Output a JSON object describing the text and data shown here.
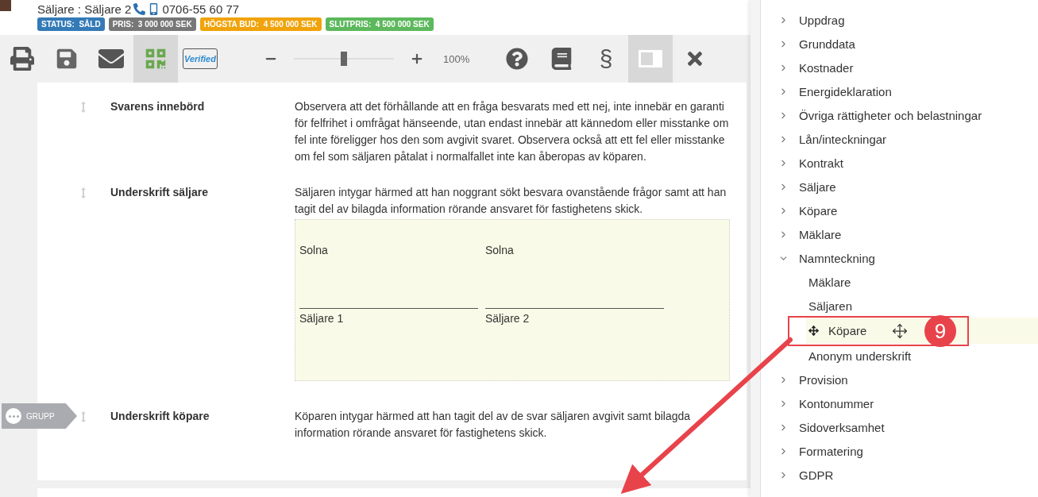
{
  "header": {
    "seller": "Säljare : Säljare 2",
    "phone": "0706-55 60 77",
    "badges": [
      {
        "label": "STATUS:  SÅLD",
        "color": "#337ab7"
      },
      {
        "label": "PRIS:  3 000 000 SEK",
        "color": "#777777"
      },
      {
        "label": "HÖGSTA BUD:  4 500 000 SEK",
        "color": "#f0a30a"
      },
      {
        "label": "SLUTPRIS:  4 500 000 SEK",
        "color": "#5cb85c"
      }
    ]
  },
  "toolbar": {
    "left": [
      {
        "kind": "print",
        "selected": false
      },
      {
        "kind": "save",
        "selected": false
      },
      {
        "kind": "mail",
        "selected": false
      },
      {
        "kind": "qr",
        "selected": true
      },
      {
        "kind": "verified",
        "label": "Verified",
        "selected": false
      }
    ],
    "zoom": {
      "level": 0.5,
      "reading": "100%"
    },
    "right": [
      {
        "kind": "help",
        "selected": false
      },
      {
        "kind": "book",
        "selected": false
      },
      {
        "kind": "section",
        "label": "§",
        "selected": false
      },
      {
        "kind": "panel",
        "selected": true
      },
      {
        "kind": "close",
        "selected": false
      }
    ]
  },
  "sections": [
    {
      "kind": "text",
      "label": "Svarens innebörd",
      "text": "Observera att det förhållande att en fråga besvarats med ett nej, inte innebär en garanti för felfrihet i omfrågat hänseende, utan endast innebär att kännedom eller misstanke om fel inte föreligger hos den som avgivit svaret. Observera också att ett fel eller misstanke om fel som säljaren påtalat i normalfallet inte kan åberopas av köparen."
    },
    {
      "kind": "signature",
      "label": "Underskrift säljare",
      "text": "Säljaren intygar härmed att han noggrant sökt besvara ovanstående frågor samt att han tagit del av bilagda information rörande ansvaret för fastighetens skick.",
      "signers": [
        {
          "place": "Solna",
          "name": "Säljare 1"
        },
        {
          "place": "Solna",
          "name": "Säljare 2"
        }
      ]
    },
    {
      "kind": "text",
      "label": "Underskrift köpare",
      "text": "Köparen intygar härmed att han tagit del av de svar säljaren avgivit samt bilagda information rörande ansvaret för fastighetens skick."
    }
  ],
  "group_tag": {
    "label": "GRUPP"
  },
  "tree": [
    {
      "label": "Uppdrag",
      "expanded": false
    },
    {
      "label": "Grunddata",
      "expanded": false
    },
    {
      "label": "Kostnader",
      "expanded": false
    },
    {
      "label": "Energideklaration",
      "expanded": false
    },
    {
      "label": "Övriga rättigheter och belastningar",
      "expanded": false
    },
    {
      "label": "Lån/inteckningar",
      "expanded": false
    },
    {
      "label": "Kontrakt",
      "expanded": false
    },
    {
      "label": "Säljare",
      "expanded": false
    },
    {
      "label": "Köpare",
      "expanded": false
    },
    {
      "label": "Mäklare",
      "expanded": false
    },
    {
      "label": "Namnteckning",
      "expanded": true,
      "children": [
        {
          "label": "Mäklare",
          "selected": false
        },
        {
          "label": "Säljaren",
          "selected": false
        },
        {
          "label": "Köpare",
          "selected": true
        },
        {
          "label": "Anonym underskrift",
          "selected": false
        }
      ]
    },
    {
      "label": "Provision",
      "expanded": false
    },
    {
      "label": "Kontonummer",
      "expanded": false
    },
    {
      "label": "Sidoverksamhet",
      "expanded": false
    },
    {
      "label": "Formatering",
      "expanded": false
    },
    {
      "label": "GDPR",
      "expanded": false
    }
  ],
  "annotation": {
    "step": "9"
  }
}
